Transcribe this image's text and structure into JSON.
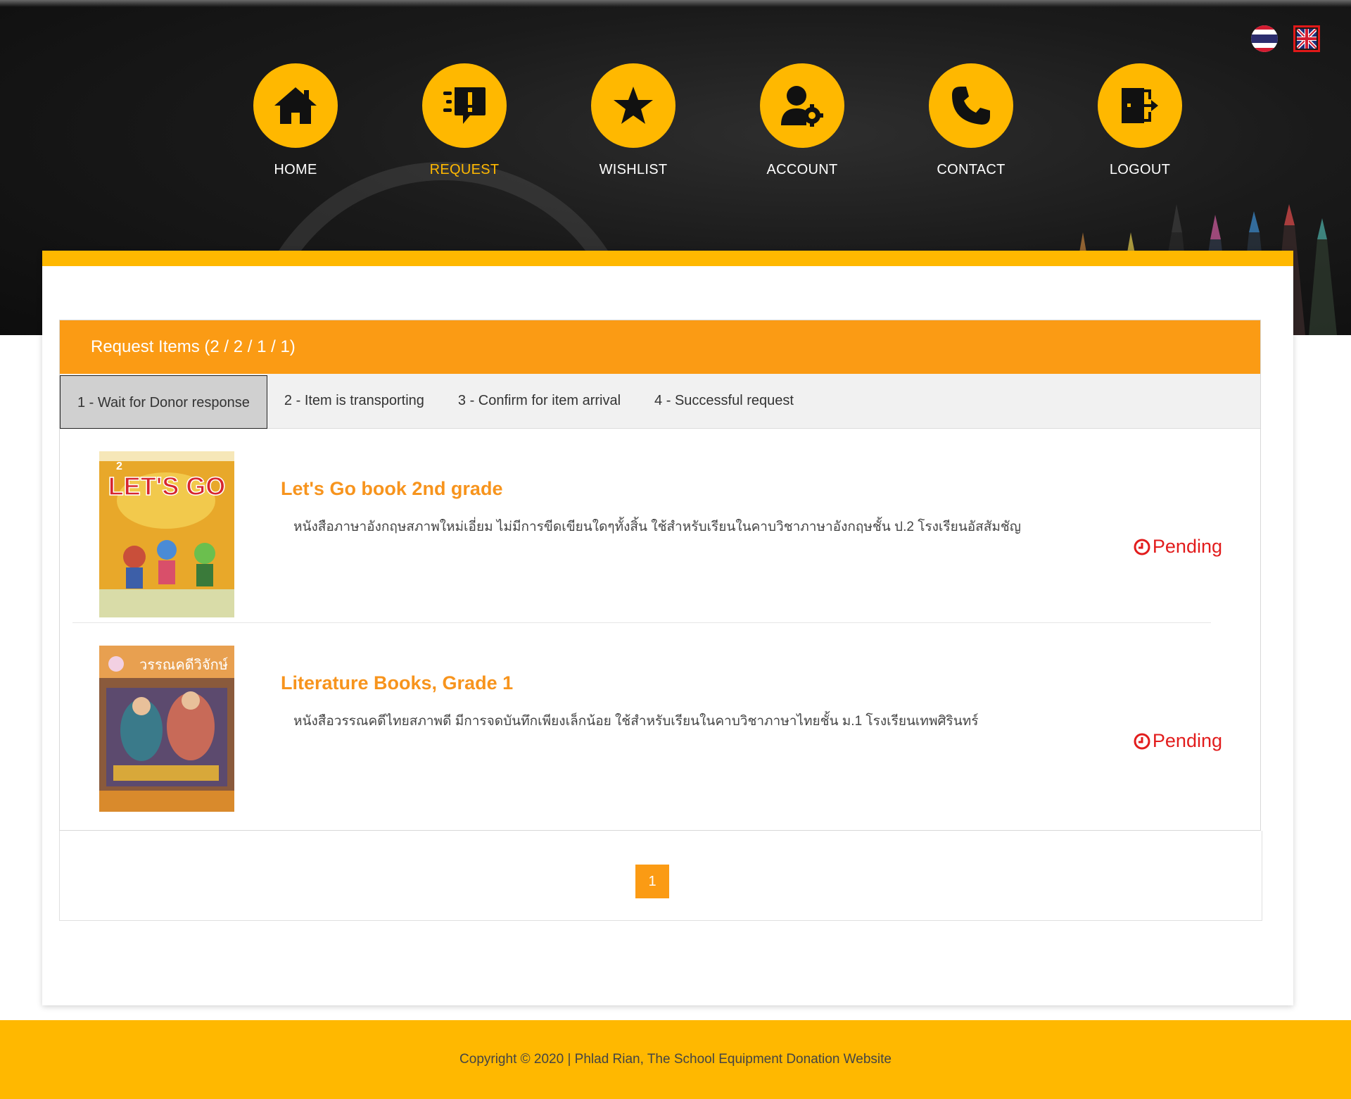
{
  "language": {
    "thai_flag": "thai-flag-icon",
    "uk_flag": "uk-flag-icon"
  },
  "nav": {
    "items": [
      {
        "label": "HOME",
        "icon": "home-icon",
        "active": false
      },
      {
        "label": "REQUEST",
        "icon": "request-icon",
        "active": true
      },
      {
        "label": "WISHLIST",
        "icon": "star-icon",
        "active": false
      },
      {
        "label": "ACCOUNT",
        "icon": "account-settings-icon",
        "active": false
      },
      {
        "label": "CONTACT",
        "icon": "phone-icon",
        "active": false
      },
      {
        "label": "LOGOUT",
        "icon": "logout-icon",
        "active": false
      }
    ]
  },
  "panel": {
    "title": "Request Items (2 / 2 / 1 / 1)",
    "tabs": [
      {
        "label": "1 - Wait for Donor response",
        "active": true
      },
      {
        "label": "2 - Item is transporting",
        "active": false
      },
      {
        "label": "3 - Confirm for item arrival",
        "active": false
      },
      {
        "label": "4 - Successful request",
        "active": false
      }
    ],
    "items": [
      {
        "title": "Let's Go book 2nd grade",
        "description": "หนังสือภาษาอังกฤษสภาพใหม่เอี่ยม ไม่มีการขีดเขียนใดๆทั้งสิ้น ใช้สำหรับเรียนในคาบวิชาภาษาอังกฤษชั้น ป.2 โรงเรียนอัสสัมชัญ",
        "status": "Pending",
        "cover_text": "LET'S GO"
      },
      {
        "title": "Literature Books, Grade 1",
        "description": "หนังสือวรรณคดีไทยสภาพดี มีการจดบันทึกเพียงเล็กน้อย ใช้สำหรับเรียนในคาบวิชาภาษาไทยชั้น ม.1 โรงเรียนเทพศิรินทร์",
        "status": "Pending",
        "cover_text": "วรรณคดีวิจักษ์"
      }
    ]
  },
  "pagination": {
    "current_page": "1"
  },
  "footer": {
    "text": "Copyright © 2020 | Phlad Rian, The School Equipment Donation Website"
  },
  "colors": {
    "accent_yellow": "#ffb800",
    "accent_orange": "#fb9b14",
    "pending_red": "#e21c1c"
  }
}
